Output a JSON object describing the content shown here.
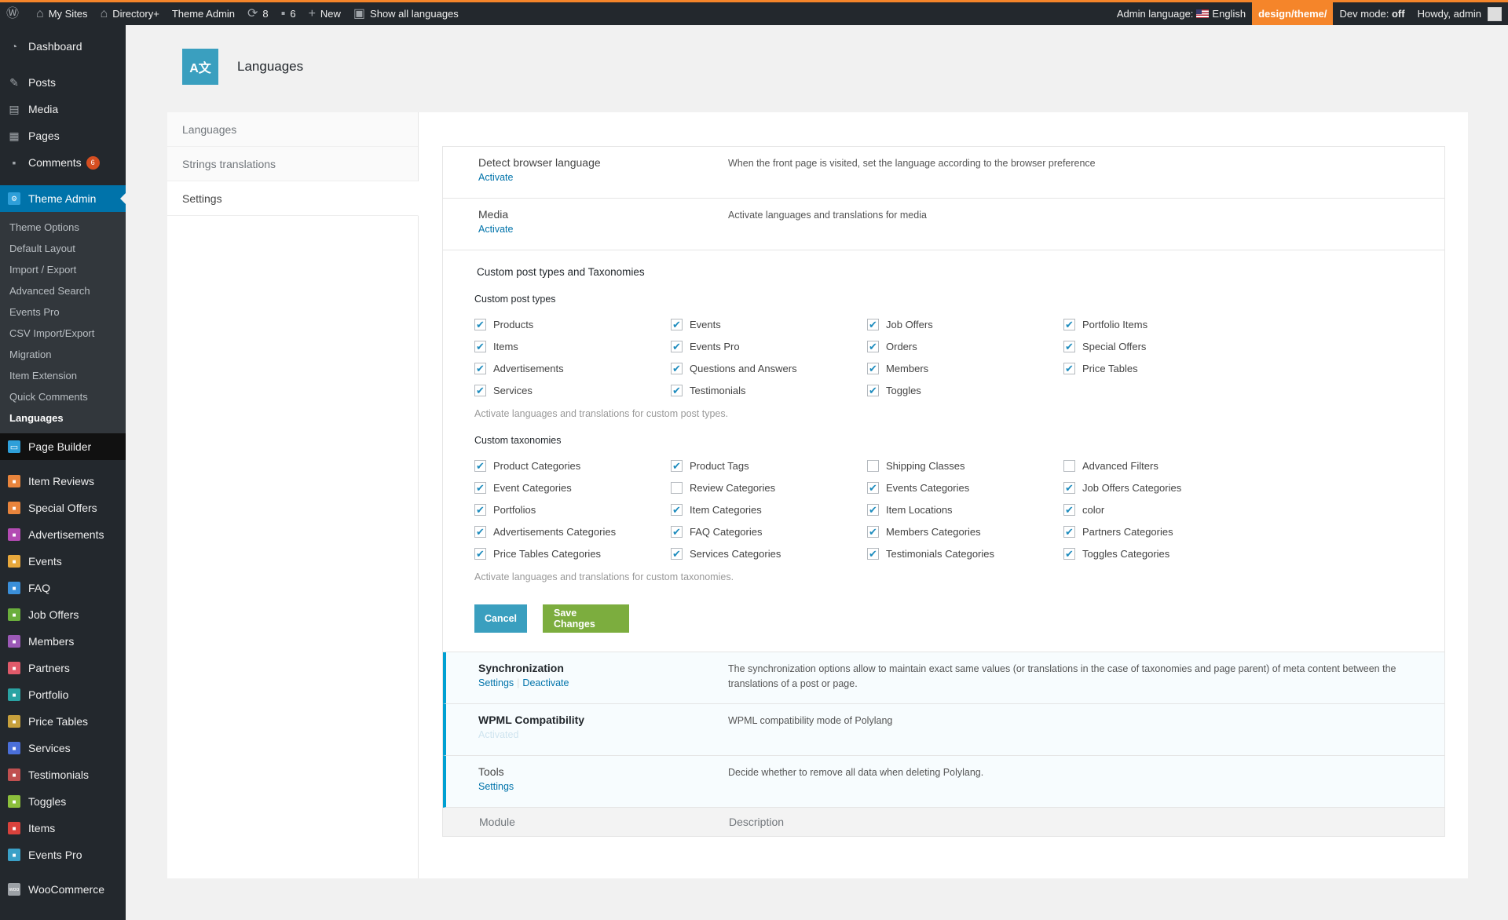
{
  "adminbar": {
    "my_sites": "My Sites",
    "site": "Directory+",
    "theme_admin": "Theme Admin",
    "updates": "8",
    "comments": "6",
    "new": "New",
    "show_languages": "Show all languages",
    "admin_language_label": "Admin language:",
    "admin_language_value": "English",
    "theme_path": "design/theme/",
    "dev_mode_label": "Dev mode:",
    "dev_mode_value": "off",
    "howdy": "Howdy, admin"
  },
  "sidebar": {
    "top": [
      {
        "label": "Dashboard",
        "icon": "dashboard-icon"
      }
    ],
    "group1": [
      {
        "label": "Posts",
        "icon": "pin-icon"
      },
      {
        "label": "Media",
        "icon": "media-icon"
      },
      {
        "label": "Pages",
        "icon": "pages-icon"
      },
      {
        "label": "Comments",
        "icon": "comments-icon",
        "badge": "6"
      }
    ],
    "theme_admin": "Theme Admin",
    "submenu": [
      "Theme Options",
      "Default Layout",
      "Import / Export",
      "Advanced Search",
      "Events Pro",
      "CSV Import/Export",
      "Migration",
      "Item Extension",
      "Quick Comments",
      "Languages"
    ],
    "page_builder": "Page Builder",
    "group2": [
      {
        "label": "Item Reviews",
        "color": "#e8843c"
      },
      {
        "label": "Special Offers",
        "color": "#e8843c"
      },
      {
        "label": "Advertisements",
        "color": "#b34bb3"
      },
      {
        "label": "Events",
        "color": "#e8a83c"
      },
      {
        "label": "FAQ",
        "color": "#3a8fd9"
      },
      {
        "label": "Job Offers",
        "color": "#6aae3c"
      },
      {
        "label": "Members",
        "color": "#9b59b6"
      },
      {
        "label": "Partners",
        "color": "#e05a6a"
      },
      {
        "label": "Portfolio",
        "color": "#2aa3a3"
      },
      {
        "label": "Price Tables",
        "color": "#c7a03c"
      },
      {
        "label": "Services",
        "color": "#4a6fd9"
      },
      {
        "label": "Testimonials",
        "color": "#c05050"
      },
      {
        "label": "Toggles",
        "color": "#8cbf3c"
      },
      {
        "label": "Items",
        "color": "#d9423c"
      },
      {
        "label": "Events Pro",
        "color": "#3aa0c7"
      }
    ],
    "woocommerce": "WooCommerce"
  },
  "page": {
    "title": "Languages"
  },
  "tabs": [
    "Languages",
    "Strings translations",
    "Settings"
  ],
  "modules_top": [
    {
      "name": "Detect browser language",
      "link": "Activate",
      "desc": "When the front page is visited, set the language according to the browser preference"
    },
    {
      "name": "Media",
      "link": "Activate",
      "desc": "Activate languages and translations for media"
    }
  ],
  "cpt_section": {
    "title": "Custom post types and Taxonomies",
    "post_types_heading": "Custom post types",
    "post_types": [
      {
        "label": "Products",
        "checked": true
      },
      {
        "label": "Events",
        "checked": true
      },
      {
        "label": "Job Offers",
        "checked": true
      },
      {
        "label": "Portfolio Items",
        "checked": true
      },
      {
        "label": "Items",
        "checked": true
      },
      {
        "label": "Events Pro",
        "checked": true
      },
      {
        "label": "Orders",
        "checked": true
      },
      {
        "label": "Special Offers",
        "checked": true
      },
      {
        "label": "Advertisements",
        "checked": true
      },
      {
        "label": "Questions and Answers",
        "checked": true
      },
      {
        "label": "Members",
        "checked": true
      },
      {
        "label": "Price Tables",
        "checked": true
      },
      {
        "label": "Services",
        "checked": true
      },
      {
        "label": "Testimonials",
        "checked": true
      },
      {
        "label": "Toggles",
        "checked": true
      }
    ],
    "post_types_help": "Activate languages and translations for custom post types.",
    "taxonomies_heading": "Custom taxonomies",
    "taxonomies": [
      {
        "label": "Product Categories",
        "checked": true
      },
      {
        "label": "Product Tags",
        "checked": true
      },
      {
        "label": "Shipping Classes",
        "checked": false
      },
      {
        "label": "Advanced Filters",
        "checked": false
      },
      {
        "label": "Event Categories",
        "checked": true
      },
      {
        "label": "Review Categories",
        "checked": false
      },
      {
        "label": "Events Categories",
        "checked": true
      },
      {
        "label": "Job Offers Categories",
        "checked": true
      },
      {
        "label": "Portfolios",
        "checked": true
      },
      {
        "label": "Item Categories",
        "checked": true
      },
      {
        "label": "Item Locations",
        "checked": true
      },
      {
        "label": "color",
        "checked": true
      },
      {
        "label": "Advertisements Categories",
        "checked": true
      },
      {
        "label": "FAQ Categories",
        "checked": true
      },
      {
        "label": "Members Categories",
        "checked": true
      },
      {
        "label": "Partners Categories",
        "checked": true
      },
      {
        "label": "Price Tables Categories",
        "checked": true
      },
      {
        "label": "Services Categories",
        "checked": true
      },
      {
        "label": "Testimonials Categories",
        "checked": true
      },
      {
        "label": "Toggles Categories",
        "checked": true
      }
    ],
    "taxonomies_help": "Activate languages and translations for custom taxonomies.",
    "cancel": "Cancel",
    "save": "Save Changes"
  },
  "modules_bottom": {
    "sync": {
      "name": "Synchronization",
      "link1": "Settings",
      "link2": "Deactivate",
      "desc": "The synchronization options allow to maintain exact same values (or translations in the case of taxonomies and page parent) of meta content between the translations of a post or page."
    },
    "wpml": {
      "name": "WPML Compatibility",
      "link": "Activated",
      "desc": "WPML compatibility mode of Polylang"
    },
    "tools": {
      "name": "Tools",
      "link": "Settings",
      "desc": "Decide whether to remove all data when deleting Polylang."
    }
  },
  "table_footer": {
    "module": "Module",
    "description": "Description"
  }
}
